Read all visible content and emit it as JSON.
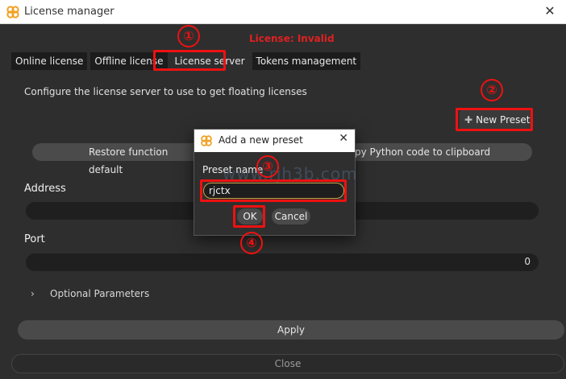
{
  "window": {
    "title": "License manager",
    "close_glyph": "✕",
    "icon": "app-logo-icon"
  },
  "license_status": "License: Invalid",
  "tabs": [
    {
      "label": "Online license"
    },
    {
      "label": "Offline license"
    },
    {
      "label": "License server",
      "active": true
    },
    {
      "label": "Tokens management"
    }
  ],
  "description": "Configure the license server to use to get floating licenses",
  "new_preset": {
    "plus": "✚",
    "label": "New Preset"
  },
  "buttons": {
    "restore": "Restore function default",
    "copy": "py Python code to clipboard",
    "apply": "Apply",
    "close": "Close"
  },
  "address": {
    "label": "Address",
    "value": ""
  },
  "port": {
    "label": "Port",
    "value": "0"
  },
  "optional": {
    "chevron": "›",
    "label": "Optional Parameters"
  },
  "dialog": {
    "title": "Add a new preset",
    "close_glyph": "✕",
    "preset_label": "Preset name",
    "preset_value": "rjctx",
    "ok": "OK",
    "cancel": "Cancel"
  },
  "markers": [
    "①",
    "②",
    "③",
    "④"
  ],
  "watermark": "www.rjh3b.com",
  "colors": {
    "annotation": "#e11111",
    "background": "#2e2e2e",
    "field": "#1f1f1f",
    "input_focus": "#c8a040"
  }
}
